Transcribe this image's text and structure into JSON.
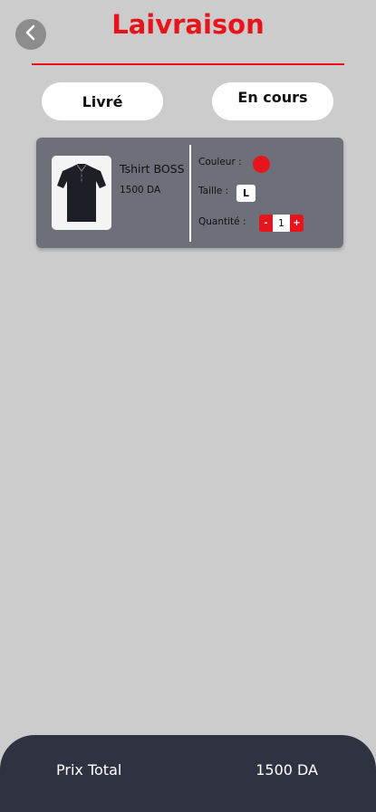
{
  "header": {
    "title": "Laivraison",
    "back_icon": "chevron-left-icon"
  },
  "tabs": [
    {
      "label": "Livré"
    },
    {
      "label": "En cours"
    }
  ],
  "order_item": {
    "name": "Tshirt BOSS",
    "price": "1500 DA",
    "image": "polo-shirt-icon",
    "color_label": "Couleur :",
    "color_value": "#e8141c",
    "size_label": "Taille :",
    "size_value": "L",
    "qty_label": "Quantité :",
    "qty_minus": "-",
    "qty_value": "1",
    "qty_plus": "+"
  },
  "footer": {
    "total_label": "Prix Total",
    "total_value": "1500 DA"
  },
  "colors": {
    "accent": "#e8141c",
    "background": "#cccccc",
    "card": "#6d7079",
    "footer": "#2f3241"
  }
}
